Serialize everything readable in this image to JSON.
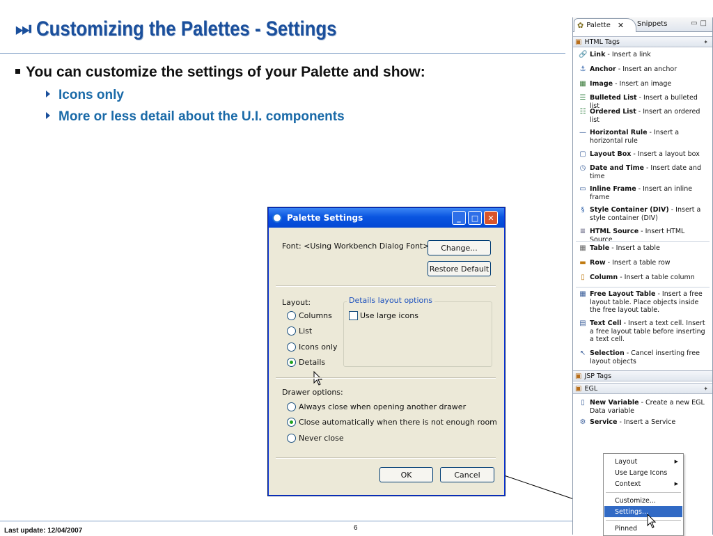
{
  "slide": {
    "title": "Customizing the Palettes - Settings",
    "title_icon": "⏭",
    "bullet_main": "You can customize the settings of your Palette and show:",
    "sub_bullets": [
      "Icons only",
      "More or less detail about the U.I. components"
    ],
    "footer": "Last update: 12/04/2007",
    "page_number": "6"
  },
  "dialog": {
    "title": "Palette Settings",
    "font_label": "Font:  <Using Workbench Dialog Font>",
    "change_button": "Change...",
    "restore_button": "Restore Default",
    "layout_label": "Layout:",
    "layout_options": [
      "Columns",
      "List",
      "Icons only",
      "Details"
    ],
    "layout_selected": "Details",
    "details_group_label": "Details layout options",
    "use_large_icons": "Use large icons",
    "use_large_icons_checked": false,
    "drawer_label": "Drawer options:",
    "drawer_options": [
      "Always close when opening another drawer",
      "Close automatically when there is not enough room",
      "Never close"
    ],
    "drawer_selected": "Close automatically when there is not enough room",
    "ok_button": "OK",
    "cancel_button": "Cancel"
  },
  "palette": {
    "tab_active": "Palette",
    "tab_other": "Snippets",
    "drawers": {
      "html_tags": "HTML Tags",
      "jsp_tags": "JSP Tags",
      "egl": "EGL"
    },
    "html_items": [
      {
        "name": "Link",
        "desc": " - Insert a link",
        "icon": "link-icon"
      },
      {
        "name": "Anchor",
        "desc": " - Insert an anchor",
        "icon": "anchor-icon"
      },
      {
        "name": "Image",
        "desc": " - Insert an image",
        "icon": "image-icon"
      },
      {
        "name": "Bulleted List",
        "desc": " - Insert a bulleted list",
        "icon": "bulleted-list-icon"
      },
      {
        "name": "Ordered List",
        "desc": " - Insert an ordered list",
        "icon": "ordered-list-icon"
      },
      {
        "name": "Horizontal Rule",
        "desc": " - Insert a horizontal rule",
        "icon": "horizontal-rule-icon"
      },
      {
        "name": "Layout Box",
        "desc": " - Insert a layout box",
        "icon": "layout-box-icon"
      },
      {
        "name": "Date and Time",
        "desc": " - Insert date and time",
        "icon": "date-time-icon"
      },
      {
        "name": "Inline Frame",
        "desc": " - Insert an inline frame",
        "icon": "inline-frame-icon"
      },
      {
        "name": "Style Container (DIV)",
        "desc": " - Insert a style container (DIV)",
        "icon": "style-container-icon"
      },
      {
        "name": "HTML Source",
        "desc": " - Insert HTML Source",
        "icon": "html-source-icon"
      },
      {
        "name": "Table",
        "desc": " - Insert a table",
        "icon": "table-icon"
      },
      {
        "name": "Row",
        "desc": " - Insert a table row",
        "icon": "row-icon"
      },
      {
        "name": "Column",
        "desc": " - Insert a table column",
        "icon": "column-icon"
      },
      {
        "name": "Free Layout Table",
        "desc": " - Insert a free layout table. Place objects inside the free layout table.",
        "icon": "free-layout-table-icon"
      },
      {
        "name": "Text Cell",
        "desc": " - Insert a text cell. Insert a free layout table before inserting a text cell.",
        "icon": "text-cell-icon"
      },
      {
        "name": "Selection",
        "desc": " - Cancel inserting free layout objects",
        "icon": "selection-icon"
      }
    ],
    "egl_items": [
      {
        "name": "New Variable",
        "desc": " - Create a new EGL Data variable",
        "icon": "new-variable-icon"
      },
      {
        "name": "Service",
        "desc": " - Insert a Service",
        "icon": "service-icon"
      }
    ]
  },
  "context_menu": {
    "items": [
      "Layout",
      "Use Large Icons",
      "Context",
      "Customize...",
      "Settings...",
      "Pinned"
    ],
    "highlighted": "Settings..."
  },
  "colors": {
    "title_blue": "#1a4f9c",
    "sub_bullet_blue": "#1a6aa8",
    "xp_titlebar": "#0a55e0",
    "menu_highlight": "#316ac5"
  }
}
